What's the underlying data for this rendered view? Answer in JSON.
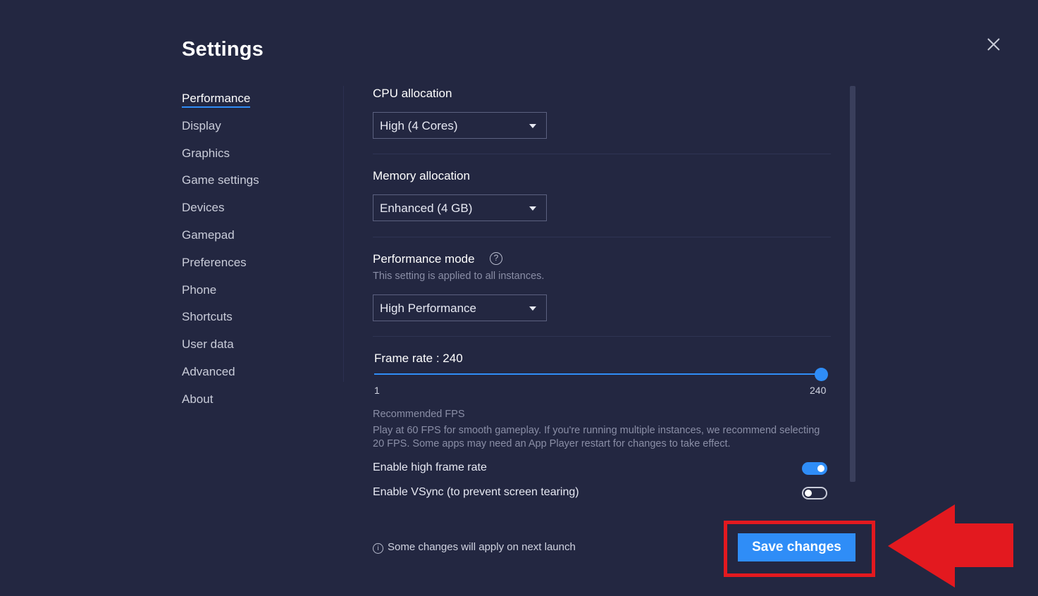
{
  "header": {
    "title": "Settings"
  },
  "sidebar": {
    "items": [
      {
        "label": "Performance",
        "active": true
      },
      {
        "label": "Display"
      },
      {
        "label": "Graphics"
      },
      {
        "label": "Game settings"
      },
      {
        "label": "Devices"
      },
      {
        "label": "Gamepad"
      },
      {
        "label": "Preferences"
      },
      {
        "label": "Phone"
      },
      {
        "label": "Shortcuts"
      },
      {
        "label": "User data"
      },
      {
        "label": "Advanced"
      },
      {
        "label": "About"
      }
    ]
  },
  "cpu": {
    "label": "CPU allocation",
    "value": "High (4 Cores)"
  },
  "memory": {
    "label": "Memory allocation",
    "value": "Enhanced (4 GB)"
  },
  "perf_mode": {
    "label": "Performance mode",
    "help_glyph": "?",
    "subtitle": "This setting is applied to all instances.",
    "value": "High Performance"
  },
  "frame_rate": {
    "label": "Frame rate : 240",
    "min_label": "1",
    "max_label": "240",
    "value": 240,
    "min": 1,
    "max": 240,
    "recommended_title": "Recommended FPS",
    "recommended_text": "Play at 60 FPS for smooth gameplay. If you're running multiple instances, we recommend selecting 20 FPS. Some apps may need an App Player restart for changes to take effect."
  },
  "toggles": {
    "high_frame_rate": {
      "label": "Enable high frame rate",
      "on": true
    },
    "vsync": {
      "label": "Enable VSync (to prevent screen tearing)",
      "on": false
    }
  },
  "footer": {
    "info_glyph": "i",
    "note": "Some changes will apply on next launch",
    "save_label": "Save changes"
  },
  "icons": {
    "close": "close-icon",
    "caret": "chevron-down-icon",
    "help": "help-circle-icon",
    "info": "info-icon"
  },
  "colors": {
    "background": "#232741",
    "accent": "#2f8df7",
    "annotation_red": "#e3191f"
  }
}
